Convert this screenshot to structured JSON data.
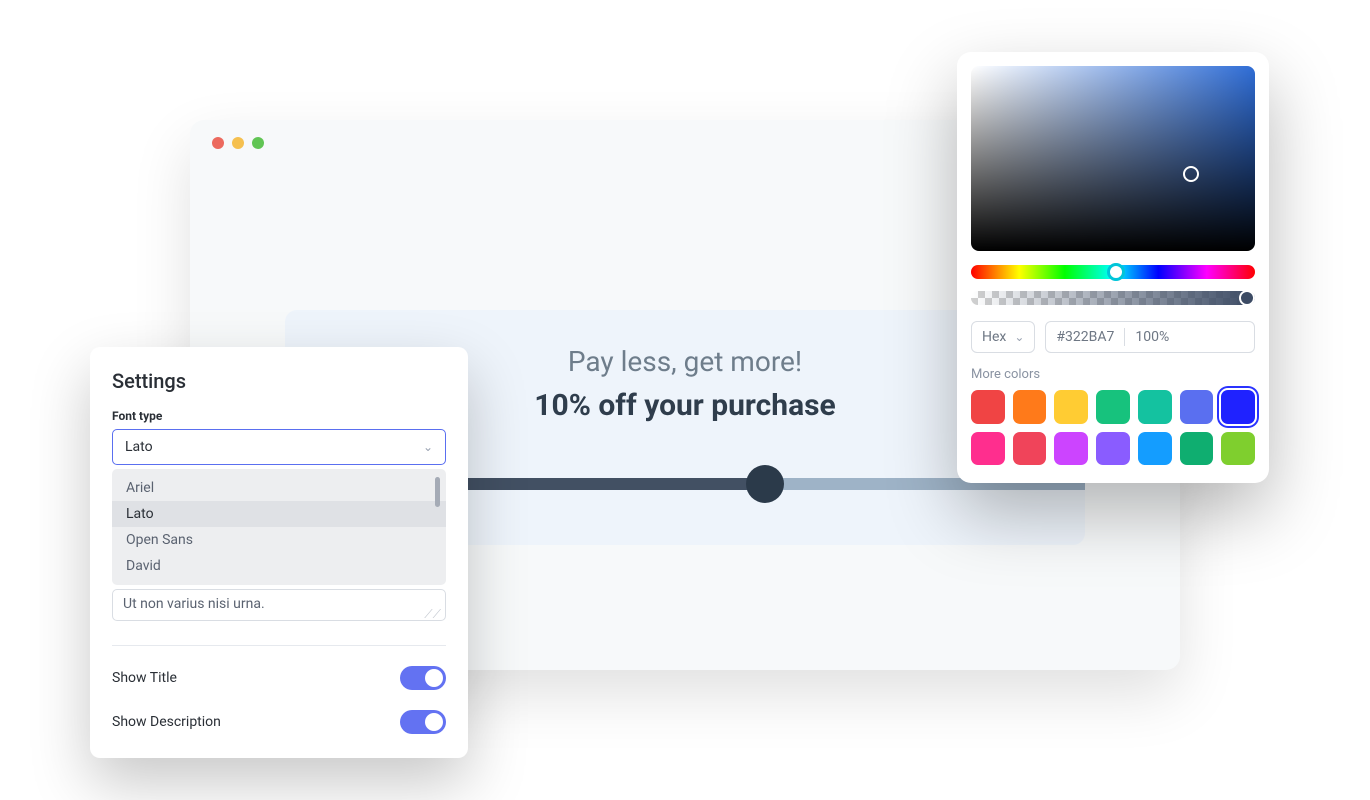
{
  "browser": {
    "heading": "Pay less, get more!",
    "subheading": "10% off your purchase",
    "slider_position_percent": 60
  },
  "settings": {
    "title": "Settings",
    "font_type_label": "Font type",
    "font_type_value": "Lato",
    "font_options": {
      "o0": "Ariel",
      "o1": "Lato",
      "o2": "Open Sans",
      "o3": "David"
    },
    "textarea_value": "Ut non varius nisi urna.",
    "show_title_label": "Show Title",
    "show_title_on": true,
    "show_description_label": "Show Description",
    "show_description_on": true
  },
  "picker": {
    "format_label": "Hex",
    "hex_value": "#322BA7",
    "opacity_value": "100%",
    "more_colors_label": "More colors",
    "swatches": {
      "s0": "#f04444",
      "s1": "#ff7a1a",
      "s2": "#ffcc33",
      "s3": "#17c27d",
      "s4": "#14c2a0",
      "s5": "#5a6ff0",
      "s6": "#1f22ff",
      "s7": "#ff2e8e",
      "s8": "#f0445a",
      "s9": "#cc44ff",
      "s10": "#8a5cff",
      "s11": "#149dff",
      "s12": "#0fae70",
      "s13": "#7fcf2e"
    },
    "selected_swatch": 6
  }
}
